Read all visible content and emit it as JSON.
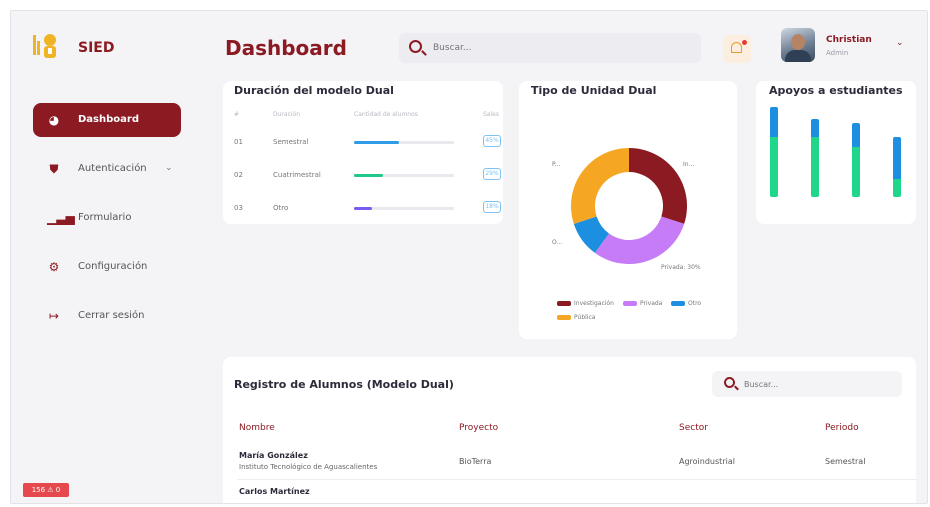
{
  "app": {
    "brand": "SIED",
    "page_title": "Dashboard"
  },
  "header": {
    "search_placeholder": "Buscar...",
    "user": {
      "name": "Christian",
      "role": "Admin"
    }
  },
  "sidebar": {
    "items": [
      {
        "label": "Dashboard",
        "icon": "pie-chart-icon",
        "active": true
      },
      {
        "label": "Autenticación",
        "icon": "shield-icon",
        "has_submenu": true
      },
      {
        "label": "Formulario",
        "icon": "bar-chart-icon"
      },
      {
        "label": "Configuración",
        "icon": "gear-icon"
      },
      {
        "label": "Cerrar sesión",
        "icon": "logout-icon"
      }
    ],
    "debug_badge": "156 ⚠ 0"
  },
  "duracion": {
    "title": "Duración del modelo Dual",
    "columns": [
      "#",
      "Duración",
      "Cantidad de alumnos",
      "Sales"
    ],
    "rows": [
      {
        "num": "01",
        "label": "Semestral",
        "fraction": 0.45,
        "color": "#2e9be6",
        "badge": "45%"
      },
      {
        "num": "02",
        "label": "Cuatrimestral",
        "fraction": 0.29,
        "color": "#1fc98a",
        "badge": "29%"
      },
      {
        "num": "03",
        "label": "Otro",
        "fraction": 0.18,
        "color": "#7b5cf0",
        "badge": "18%"
      }
    ]
  },
  "tipo_unidad": {
    "title": "Tipo de Unidad Dual",
    "slice_labels": {
      "investigacion": "In...",
      "privada": "Privada: 30%",
      "otro": "O...",
      "publica": "P..."
    },
    "legend": [
      {
        "label": "Investigación",
        "color": "#8b1a22"
      },
      {
        "label": "Privada",
        "color": "#c77cf7"
      },
      {
        "label": "Otro",
        "color": "#1d8fe0"
      },
      {
        "label": "Pública",
        "color": "#f5a623"
      }
    ]
  },
  "chart_data": {
    "type": "pie",
    "title": "Tipo de Unidad Dual",
    "categories": [
      "Investigación",
      "Privada",
      "Otro",
      "Pública"
    ],
    "values": [
      30,
      30,
      10,
      30
    ],
    "colors": [
      "#8b1a22",
      "#c77cf7",
      "#1d8fe0",
      "#f5a623"
    ],
    "donut": true,
    "legend": "bottom"
  },
  "apoyos": {
    "title": "Apoyos a estudiantes",
    "series": [
      {
        "values": [
          25,
          15,
          20,
          35
        ],
        "color": "#1d8fe0"
      },
      {
        "values": [
          50,
          50,
          42,
          15
        ],
        "color": "#1fd68a"
      }
    ]
  },
  "registro": {
    "title": "Registro de Alumnos (Modelo Dual)",
    "search_placeholder": "Buscar...",
    "columns": [
      "Nombre",
      "Proyecto",
      "Sector",
      "Periodo"
    ],
    "rows": [
      {
        "nombre": "María González",
        "institucion": "Instituto Tecnológico de Aguascalientes",
        "proyecto": "BioTerra",
        "sector": "Agroindustrial",
        "periodo": "Semestral"
      },
      {
        "nombre": "Carlos Martínez",
        "institucion": "",
        "proyecto": "",
        "sector": "",
        "periodo": ""
      }
    ]
  }
}
